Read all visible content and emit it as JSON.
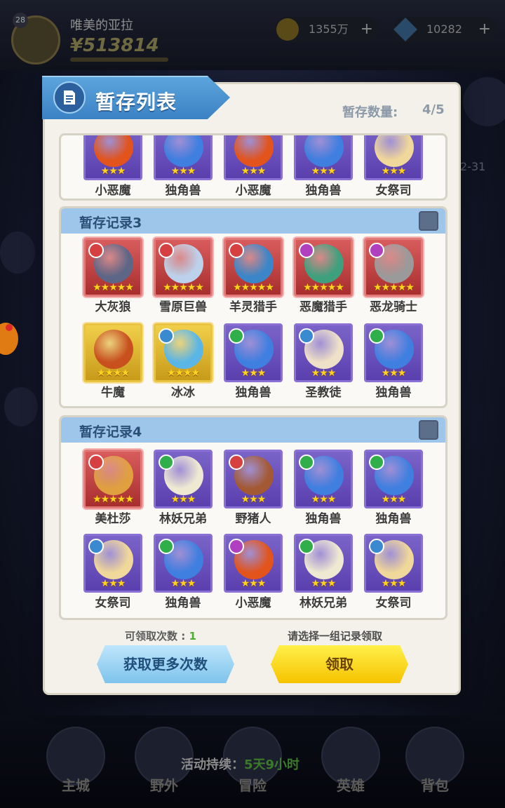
{
  "background": {
    "player": {
      "level": "28",
      "name": "唯美的亚拉",
      "money": "¥513814"
    },
    "resources": [
      {
        "icon": "coin-icon",
        "value": "1355万"
      },
      {
        "icon": "gem-icon",
        "value": "10282"
      }
    ],
    "side_text": "2-31",
    "event": {
      "label": "活动持续：",
      "value": "5天9小时"
    },
    "nav": [
      {
        "label": "主城"
      },
      {
        "label": "野外"
      },
      {
        "label": "冒险"
      },
      {
        "label": "英雄"
      },
      {
        "label": "背包"
      }
    ]
  },
  "dialog": {
    "title": "暂存列表",
    "count_label": "暂存数量:",
    "count_value": "4/5",
    "records": [
      {
        "title": "",
        "rows": [
          [
            {
              "name": "小恶魔",
              "stars": 3,
              "rarity": "purple",
              "color": "#e2541c"
            },
            {
              "name": "独角兽",
              "stars": 3,
              "rarity": "purple",
              "color": "#3f7fe0"
            },
            {
              "name": "小恶魔",
              "stars": 3,
              "rarity": "purple",
              "color": "#e2541c"
            },
            {
              "name": "独角兽",
              "stars": 3,
              "rarity": "purple",
              "color": "#3f7fe0"
            },
            {
              "name": "女祭司",
              "stars": 3,
              "rarity": "purple",
              "color": "#f0d79a"
            }
          ]
        ]
      },
      {
        "title": "暂存记录3",
        "rows": [
          [
            {
              "name": "大灰狼",
              "stars": 5,
              "rarity": "red",
              "color": "#5d6686",
              "badge": "#d64040"
            },
            {
              "name": "雪原巨兽",
              "stars": 5,
              "rarity": "red",
              "color": "#bcd2ec",
              "badge": "#d64040"
            },
            {
              "name": "羊灵猎手",
              "stars": 5,
              "rarity": "red",
              "color": "#3a86c8",
              "badge": "#d64040"
            },
            {
              "name": "恶魔猎手",
              "stars": 5,
              "rarity": "red",
              "color": "#3fa07e",
              "badge": "#b040c0"
            },
            {
              "name": "恶龙骑士",
              "stars": 5,
              "rarity": "red",
              "color": "#9a9a9a",
              "badge": "#b040c0"
            }
          ],
          [
            {
              "name": "牛魔",
              "stars": 4,
              "rarity": "gold",
              "color": "#c8501e"
            },
            {
              "name": "冰冰",
              "stars": 4,
              "rarity": "gold",
              "color": "#5ab6e6",
              "badge": "#3a8ad0"
            },
            {
              "name": "独角兽",
              "stars": 3,
              "rarity": "purple",
              "color": "#3f7fe0",
              "badge": "#2fae4a"
            },
            {
              "name": "圣教徒",
              "stars": 3,
              "rarity": "purple",
              "color": "#efe0c8",
              "badge": "#3a8ad0"
            },
            {
              "name": "独角兽",
              "stars": 3,
              "rarity": "purple",
              "color": "#3f7fe0",
              "badge": "#2fae4a"
            }
          ]
        ]
      },
      {
        "title": "暂存记录4",
        "rows": [
          [
            {
              "name": "美杜莎",
              "stars": 5,
              "rarity": "red",
              "color": "#e0a040",
              "badge": "#d64040"
            },
            {
              "name": "林妖兄弟",
              "stars": 3,
              "rarity": "purple",
              "color": "#efe9d2",
              "badge": "#2fae4a"
            },
            {
              "name": "野猪人",
              "stars": 3,
              "rarity": "purple",
              "color": "#a35a34",
              "badge": "#d64040"
            },
            {
              "name": "独角兽",
              "stars": 3,
              "rarity": "purple",
              "color": "#3f7fe0",
              "badge": "#2fae4a"
            },
            {
              "name": "独角兽",
              "stars": 3,
              "rarity": "purple",
              "color": "#3f7fe0",
              "badge": "#2fae4a"
            }
          ],
          [
            {
              "name": "女祭司",
              "stars": 3,
              "rarity": "purple",
              "color": "#f0d79a",
              "badge": "#3a8ad0"
            },
            {
              "name": "独角兽",
              "stars": 3,
              "rarity": "purple",
              "color": "#3f7fe0",
              "badge": "#2fae4a"
            },
            {
              "name": "小恶魔",
              "stars": 3,
              "rarity": "purple",
              "color": "#e2541c",
              "badge": "#b040c0"
            },
            {
              "name": "林妖兄弟",
              "stars": 3,
              "rarity": "purple",
              "color": "#efe9d2",
              "badge": "#2fae4a"
            },
            {
              "name": "女祭司",
              "stars": 3,
              "rarity": "purple",
              "color": "#f0d79a",
              "badge": "#3a8ad0"
            }
          ]
        ]
      }
    ],
    "claims_label": "可领取次数 : ",
    "claims_value": "1",
    "hint": "请选择一组记录领取",
    "btn_more": "获取更多次数",
    "btn_claim": "领取"
  }
}
